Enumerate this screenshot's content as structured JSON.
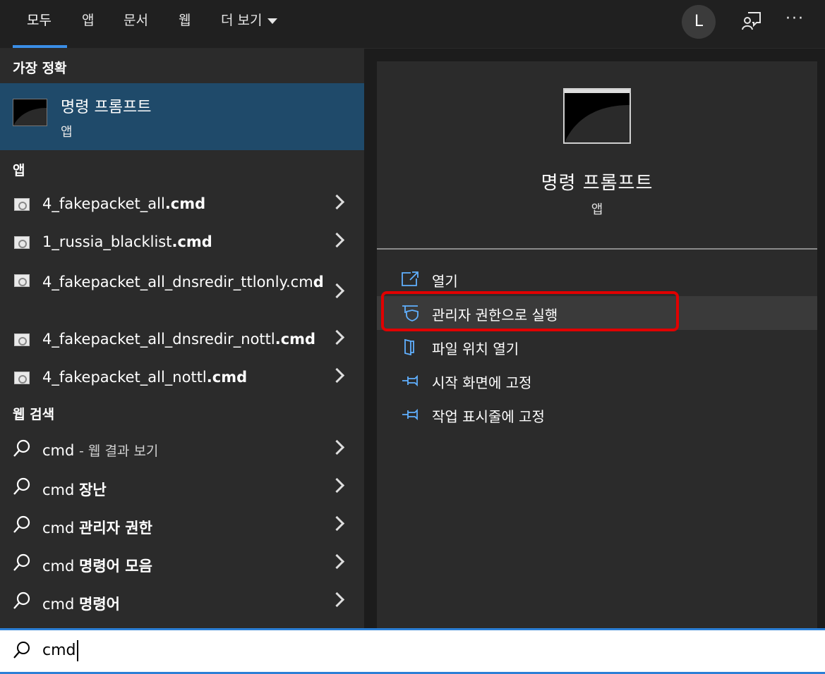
{
  "header": {
    "tabs": [
      {
        "label": "모두",
        "active": true
      },
      {
        "label": "앱"
      },
      {
        "label": "문서"
      },
      {
        "label": "웹"
      },
      {
        "label": "더 보기"
      }
    ],
    "avatar_initial": "L",
    "accent_color": "#3a8ee6"
  },
  "left": {
    "best_match_heading": "가장 정확",
    "best_match": {
      "title": "명령 프롬프트",
      "subtitle": "앱"
    },
    "apps_heading": "앱",
    "apps": [
      {
        "name": "4_fakepacket_all",
        "ext": ".cmd"
      },
      {
        "name": "1_russia_blacklist",
        "ext": ".cmd"
      },
      {
        "name": "4_fakepacket_all_dnsredir_ttlonly.cm",
        "ext": "d"
      },
      {
        "name": "4_fakepacket_all_dnsredir_nottl",
        "ext": ".cmd"
      },
      {
        "name": "4_fakepacket_all_nottl",
        "ext": ".cmd"
      }
    ],
    "web_heading": "웹 검색",
    "web": [
      {
        "query": "cmd",
        "suffix": "- 웹 결과 보기"
      },
      {
        "query": "cmd",
        "suffix": "장난"
      },
      {
        "query": "cmd",
        "suffix": "관리자 권한"
      },
      {
        "query": "cmd",
        "suffix": "명령어 모음"
      },
      {
        "query": "cmd",
        "suffix": "명령어"
      }
    ]
  },
  "right": {
    "title": "명령 프롬프트",
    "subtitle": "앱",
    "actions": [
      {
        "label": "열기",
        "icon": "open-icon"
      },
      {
        "label": "관리자 권한으로 실행",
        "icon": "shield-icon",
        "highlighted": true
      },
      {
        "label": "파일 위치 열기",
        "icon": "file-location-icon"
      },
      {
        "label": "시작 화면에 고정",
        "icon": "pin-icon"
      },
      {
        "label": "작업 표시줄에 고정",
        "icon": "pin-icon"
      }
    ]
  },
  "search": {
    "value": "cmd"
  }
}
